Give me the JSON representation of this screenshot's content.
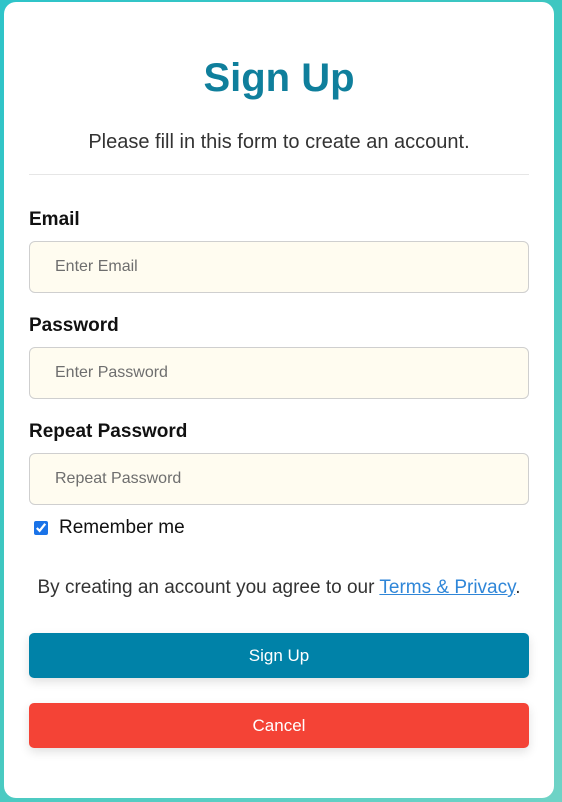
{
  "form": {
    "title": "Sign Up",
    "subtitle": "Please fill in this form to create an account.",
    "email": {
      "label": "Email",
      "placeholder": "Enter Email",
      "value": ""
    },
    "password": {
      "label": "Password",
      "placeholder": "Enter Password",
      "value": ""
    },
    "repeat_password": {
      "label": "Repeat Password",
      "placeholder": "Repeat Password",
      "value": ""
    },
    "remember": {
      "label": "Remember me",
      "checked": true
    },
    "terms": {
      "prefix": "By creating an account you agree to our ",
      "link_text": "Terms & Privacy",
      "suffix": "."
    },
    "signup_label": "Sign Up",
    "cancel_label": "Cancel"
  },
  "colors": {
    "title": "#0f7f9c",
    "signup_button": "#0082a8",
    "cancel_button": "#f44336",
    "input_background": "#fffcf0",
    "link": "#2f86d8",
    "page_background": "#3fc7c0"
  }
}
